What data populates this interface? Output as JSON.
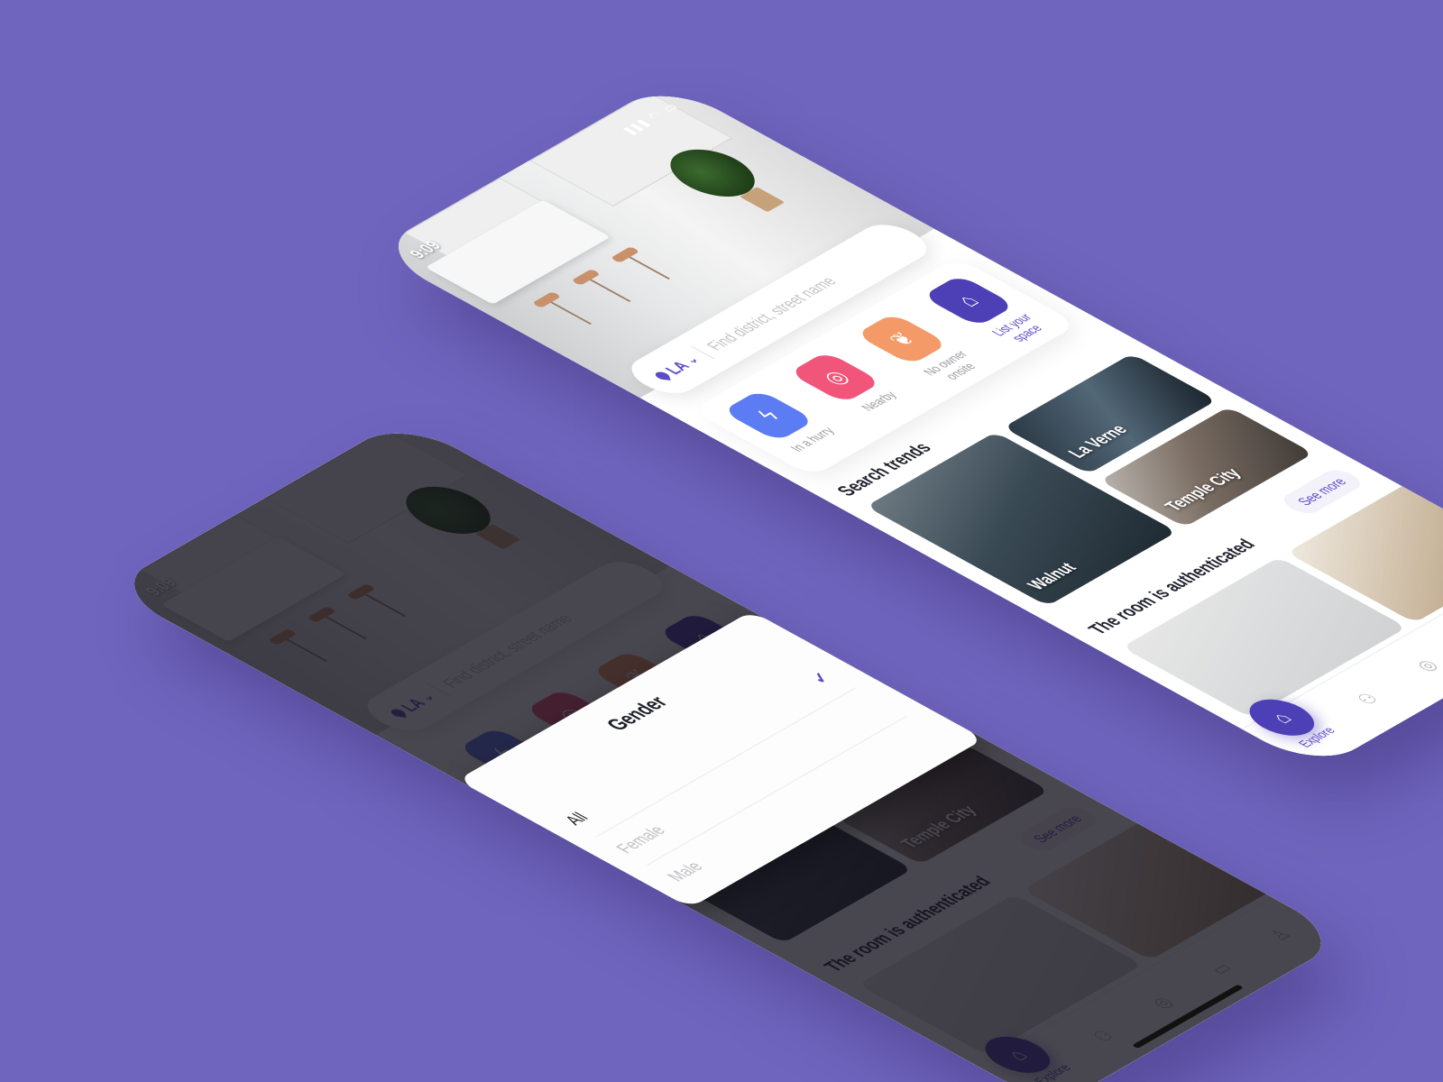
{
  "status_bar": {
    "time": "9:09"
  },
  "search": {
    "city": "LA",
    "placeholder": "Find district, street name"
  },
  "actions": [
    {
      "label": "In a hurry",
      "icon": "bolt-icon"
    },
    {
      "label": "Nearby",
      "icon": "target-icon"
    },
    {
      "label": "No owner onsite",
      "icon": "handshake-icon"
    },
    {
      "label": "List your space",
      "icon": "house-icon"
    }
  ],
  "trends": {
    "title": "Search trends",
    "items": [
      "Walnut",
      "La Verne",
      "Temple City"
    ]
  },
  "rooms": {
    "title": "The room is authenticated",
    "see_more": "See more"
  },
  "nav": {
    "explore": "Explore",
    "items": [
      "roommates-icon",
      "target-icon",
      "chat-icon",
      "profile-icon"
    ]
  },
  "gender_picker": {
    "title": "Gender",
    "options": [
      "All",
      "Female",
      "Male"
    ],
    "selected": "All"
  },
  "colors": {
    "background": "#6f65be",
    "accent": "#4d3fb5",
    "blue": "#5b7cf3",
    "pink": "#f2557a",
    "orange": "#f39a68"
  }
}
